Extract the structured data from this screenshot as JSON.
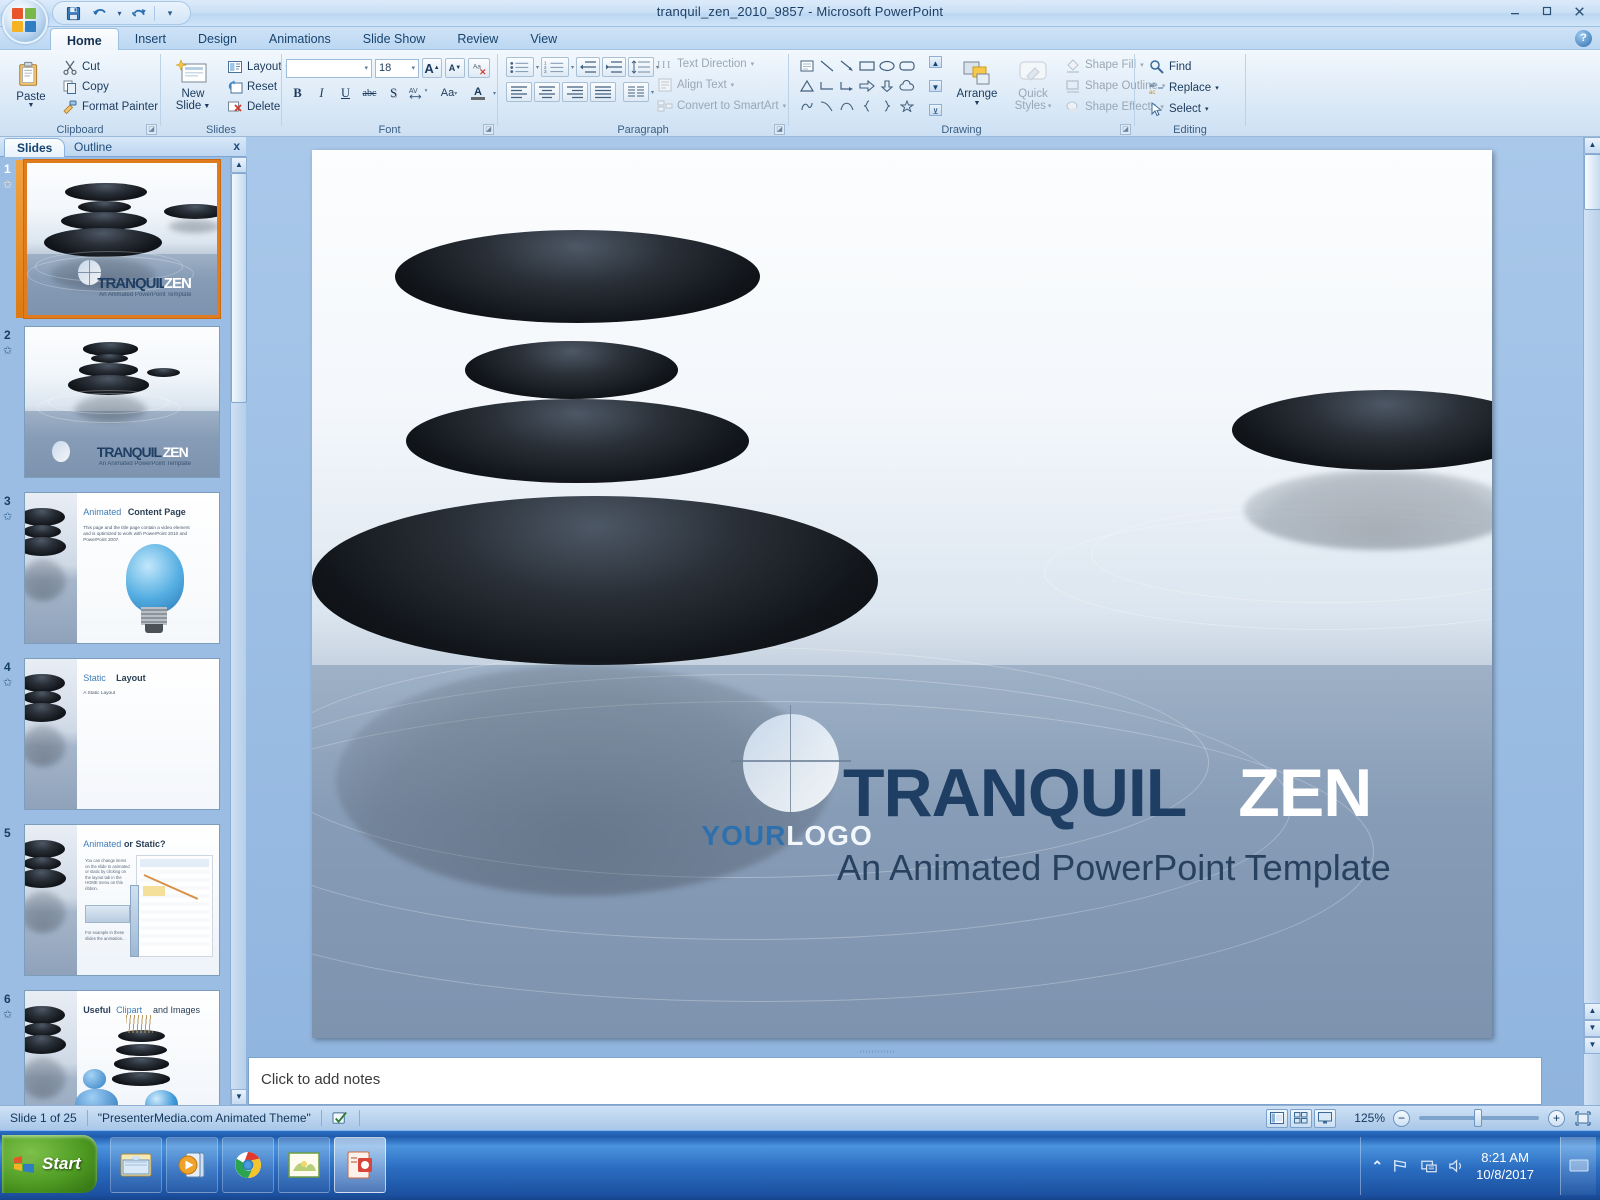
{
  "window": {
    "title": "tranquil_zen_2010_9857 - Microsoft PowerPoint",
    "minimize": "—",
    "maximize": "▭",
    "close": "✕",
    "help": "?"
  },
  "quick_access": {
    "save": "save-icon",
    "undo": "undo-icon",
    "redo": "redo-icon",
    "customize": "customize-icon"
  },
  "ribbon": {
    "tabs": [
      {
        "label": "Home",
        "active": true
      },
      {
        "label": "Insert",
        "active": false
      },
      {
        "label": "Design",
        "active": false
      },
      {
        "label": "Animations",
        "active": false
      },
      {
        "label": "Slide Show",
        "active": false
      },
      {
        "label": "Review",
        "active": false
      },
      {
        "label": "View",
        "active": false
      }
    ],
    "clipboard": {
      "group_label": "Clipboard",
      "paste": "Paste",
      "cut": "Cut",
      "copy": "Copy",
      "format_painter": "Format Painter"
    },
    "slides": {
      "group_label": "Slides",
      "new_slide_line1": "New",
      "new_slide_line2": "Slide",
      "layout": "Layout",
      "reset": "Reset",
      "delete": "Delete"
    },
    "font": {
      "group_label": "Font",
      "font_name": "",
      "font_size": "18",
      "grow": "A",
      "shrink": "A",
      "clear_formatting": "Aa",
      "bold": "B",
      "italic": "I",
      "underline": "U",
      "strikethrough": "abc",
      "shadow": "S",
      "spacing": "AV",
      "change_case": "Aa",
      "font_color": "A"
    },
    "paragraph": {
      "group_label": "Paragraph",
      "text_direction": "Text Direction",
      "align_text": "Align Text",
      "convert_to_smartart": "Convert to SmartArt"
    },
    "drawing": {
      "group_label": "Drawing",
      "arrange": "Arrange",
      "quick_styles_line1": "Quick",
      "quick_styles_line2": "Styles",
      "shape_fill": "Shape Fill",
      "shape_outline": "Shape Outline",
      "shape_effects": "Shape Effects"
    },
    "editing": {
      "group_label": "Editing",
      "find": "Find",
      "replace": "Replace",
      "select": "Select"
    }
  },
  "left_pane": {
    "tab_slides": "Slides",
    "tab_outline": "Outline",
    "close": "x",
    "thumbnails": [
      {
        "number": "1",
        "kind": "title",
        "title_dark": "TRANQUIL",
        "title_light": "ZEN",
        "subtitle": "An Animated PowerPoint Template",
        "selected": true
      },
      {
        "number": "2",
        "kind": "title",
        "title_dark": "TRANQUIL",
        "title_light": "ZEN",
        "subtitle": "An Animated PowerPoint Template",
        "selected": false
      },
      {
        "number": "3",
        "kind": "content",
        "heading_a": "Animated",
        "heading_b": "Content Page",
        "body": "This page and the title page contain a video element and is optimized to work with PowerPoint 2010 and PowerPoint 2007.",
        "selected": false
      },
      {
        "number": "4",
        "kind": "static",
        "heading_a": "Static",
        "heading_b": "Layout",
        "body": "A Static Layout",
        "selected": false
      },
      {
        "number": "5",
        "kind": "animated-or-static",
        "heading_a": "Animated",
        "heading_b": "or Static?",
        "body": "You can change items on the slide to animated or static by clicking on the layout tab in the HOME menu on this ribbon.",
        "body2": "For example in these slides the animation...",
        "selected": false
      },
      {
        "number": "6",
        "kind": "clipart",
        "heading_a": "Useful",
        "heading_b": "Clipart",
        "heading_c": "and Images",
        "selected": false
      }
    ]
  },
  "slide": {
    "title_dark": "TRANQUIL",
    "title_light": "ZEN",
    "subtitle": "An Animated PowerPoint Template",
    "logo_first": "YOUR",
    "logo_second": "LOGO"
  },
  "notes": {
    "placeholder": "Click to add notes"
  },
  "status_bar": {
    "slide_counter": "Slide 1 of 25",
    "theme": "\"PresenterMedia.com Animated Theme\"",
    "spellcheck_icon": "spellcheck-icon",
    "view_normal": "normal-view-icon",
    "view_sorter": "slide-sorter-icon",
    "view_show": "slide-show-icon",
    "zoom_level": "125%",
    "zoom_out": "−",
    "zoom_in": "+",
    "fit_to_window": "fit-slide-icon"
  },
  "taskbar": {
    "start": "Start",
    "items": [
      {
        "name": "windows-explorer",
        "active": false
      },
      {
        "name": "media-player",
        "active": false
      },
      {
        "name": "google-chrome",
        "active": false
      },
      {
        "name": "photo-viewer",
        "active": false
      },
      {
        "name": "powerpoint",
        "active": true
      }
    ],
    "tray": {
      "show_hidden": "⌃",
      "network": "network-icon",
      "action_center": "action-center-icon",
      "volume": "volume-icon"
    },
    "time": "8:21 AM",
    "date": "10/8/2017"
  },
  "colors": {
    "accent_blue": "#1f3e63",
    "ribbon_bg": "#e3eef9",
    "selection_orange": "#e07b1e",
    "taskbar_blue": "#2a6cc0"
  }
}
